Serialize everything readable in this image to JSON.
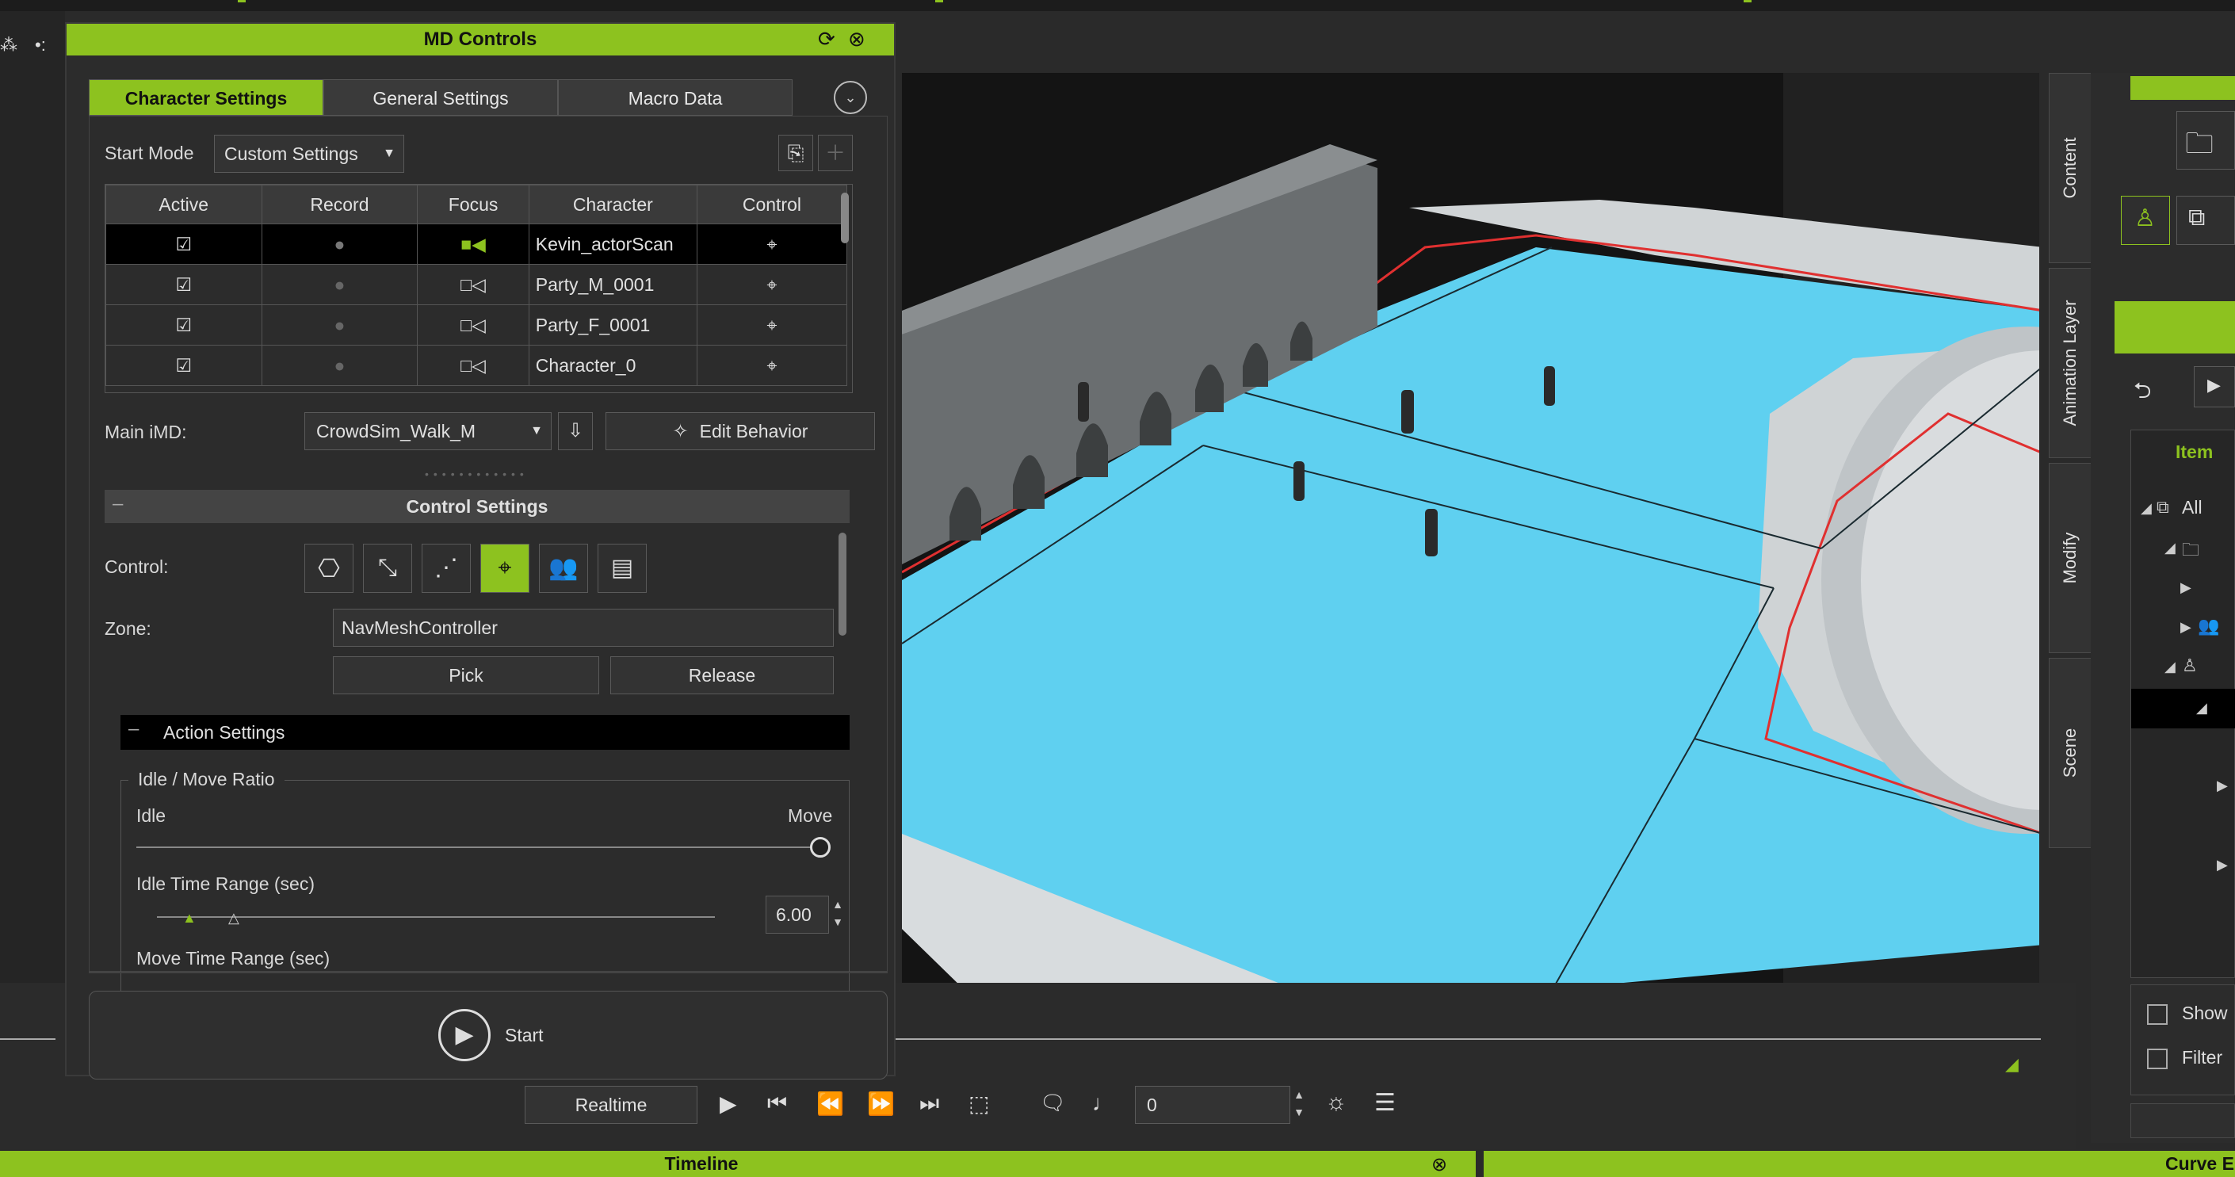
{
  "md_panel": {
    "title": "MD Controls",
    "tabs": [
      "Character Settings",
      "General Settings",
      "Macro Data"
    ],
    "start_mode_label": "Start Mode",
    "start_mode_value": "Custom Settings",
    "table": {
      "headers": [
        "Active",
        "Record",
        "Focus",
        "Character",
        "Control"
      ],
      "rows": [
        {
          "name": "Kevin_actorScan",
          "selected": true
        },
        {
          "name": "Party_M_0001",
          "selected": false
        },
        {
          "name": "Party_F_0001",
          "selected": false
        },
        {
          "name": "Character_0",
          "selected": false
        }
      ]
    },
    "main_imd_label": "Main iMD:",
    "main_imd_value": "CrowdSim_Walk_M",
    "edit_behavior_label": "Edit Behavior",
    "control_settings_title": "Control Settings",
    "control_label": "Control:",
    "zone_label": "Zone:",
    "zone_value": "NavMeshController",
    "pick_label": "Pick",
    "release_label": "Release",
    "action_settings_title": "Action Settings",
    "idle_move_ratio_title": "Idle / Move Ratio",
    "idle_label": "Idle",
    "move_label": "Move",
    "idle_move_ratio_value": 1.0,
    "idle_time_range_label": "Idle Time Range (sec)",
    "idle_time_value": "6.00",
    "move_time_range_label": "Move Time Range (sec)",
    "start_label": "Start"
  },
  "side_tabs": [
    "Content",
    "Animation Layer",
    "Modify",
    "Scene"
  ],
  "right_panel": {
    "item_label": "Item",
    "all_label": "All",
    "show_label": "Show",
    "filter_label": "Filter"
  },
  "playback": {
    "realtime_label": "Realtime",
    "frame_value": "0"
  },
  "bottom": {
    "timeline_label": "Timeline",
    "curve_label": "Curve E"
  },
  "colors": {
    "accent": "#8dc21f",
    "floor": "#5fd0f0"
  }
}
